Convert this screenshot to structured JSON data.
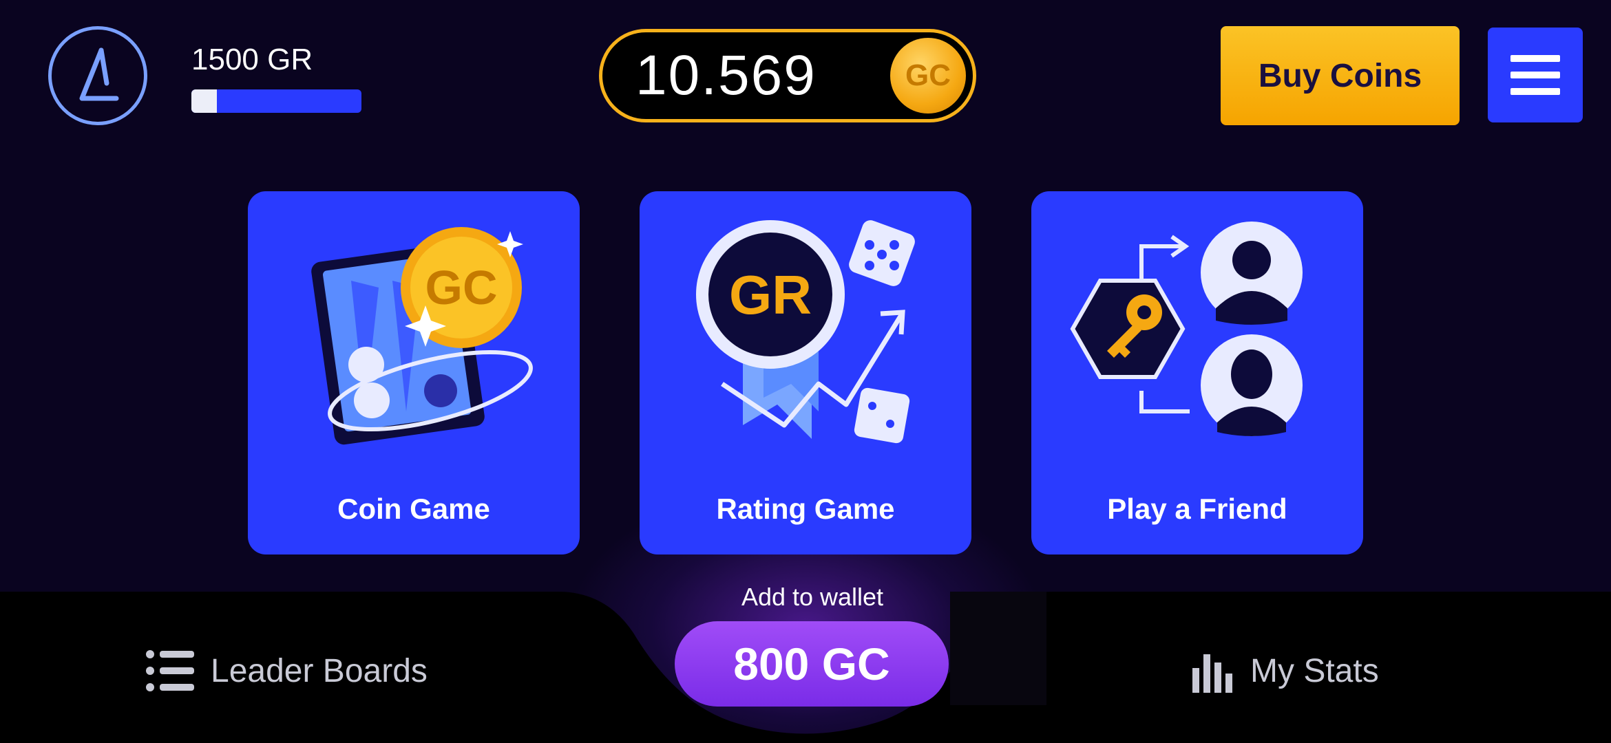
{
  "header": {
    "rating_text": "1500 GR",
    "rating_progress": 0.15,
    "balance": "10.569",
    "coin_symbol": "GC",
    "buy_label": "Buy Coins"
  },
  "games": [
    {
      "label": "Coin Game",
      "icon": "coin-game-icon"
    },
    {
      "label": "Rating Game",
      "icon": "rating-game-icon",
      "badge": "GR"
    },
    {
      "label": "Play a Friend",
      "icon": "play-friend-icon"
    }
  ],
  "wallet": {
    "label": "Add to wallet",
    "amount": "800 GC"
  },
  "nav": {
    "leaderboards": "Leader Boards",
    "stats": "My Stats"
  },
  "colors": {
    "background": "#0a0420",
    "card": "#2a3bff",
    "gold": "#f7b21b",
    "purple": "#8b3cf0"
  }
}
